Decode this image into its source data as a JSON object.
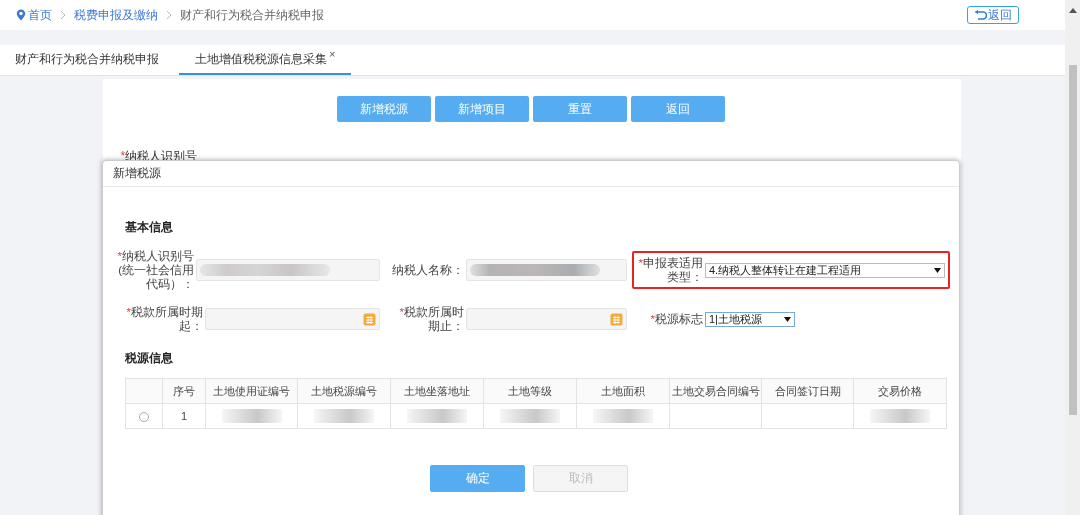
{
  "breadcrumb": [
    {
      "label": "首页",
      "kind": "home"
    },
    {
      "label": "税费申报及缴纳",
      "kind": "link"
    },
    {
      "label": "财产和行为税合并纳税申报",
      "kind": "current"
    }
  ],
  "back_button": {
    "label": "返回"
  },
  "tabs": [
    {
      "label": "财产和行为税合并纳税申报",
      "selected": false
    },
    {
      "label": "土地增值税税源信息采集",
      "selected": true,
      "close": "×"
    }
  ],
  "toolbar": [
    "新增税源",
    "新增项目",
    "重置",
    "返回"
  ],
  "background_label": {
    "required_mark": "*",
    "label": "纳税人识别号"
  },
  "dialog": {
    "title": "新增税源",
    "basic_info": {
      "title": "基本信息",
      "rows": [
        [
          {
            "required_mark": "*",
            "label": "纳税人识别号(统一社会信用代码）：",
            "kind": "text",
            "redacted": true,
            "highlighted": false
          },
          {
            "label": "纳税人名称：",
            "kind": "text",
            "redacted": true,
            "highlighted": false
          },
          {
            "required_mark": "*",
            "label": "申报表适用类型：",
            "kind": "select",
            "value": "4.纳税人整体转让在建工程适用",
            "highlighted": true
          }
        ],
        [
          {
            "required_mark": "*",
            "label": "税款所属时期起：",
            "kind": "date",
            "redacted": false,
            "highlighted": false
          },
          {
            "required_mark": "*",
            "label": "税款所属时期止：",
            "kind": "date",
            "redacted": false,
            "highlighted": false
          },
          {
            "required_mark": "*",
            "label": "税源标志",
            "kind": "select",
            "value": "1|土地税源",
            "highlighted": false
          }
        ]
      ]
    },
    "tax_source_info": {
      "title": "税源信息",
      "columns": [
        "序号",
        "土地使用证编号",
        "土地税源编号",
        "土地坐落地址",
        "土地等级",
        "土地面积",
        "土地交易合同编号",
        "合同签订日期",
        "交易价格"
      ],
      "rows": [
        {
          "selected": false,
          "number": "1",
          "cells": [
            {
              "redacted": true
            },
            {
              "redacted": true
            },
            {
              "redacted": true
            },
            {
              "redacted": true
            },
            {
              "redacted": true
            },
            {
              "redacted": false
            },
            {
              "redacted": false
            },
            {
              "redacted": true
            }
          ]
        }
      ]
    },
    "buttons": [
      {
        "label": "确定",
        "disabled": false
      },
      {
        "label": "取消",
        "disabled": true
      }
    ]
  }
}
